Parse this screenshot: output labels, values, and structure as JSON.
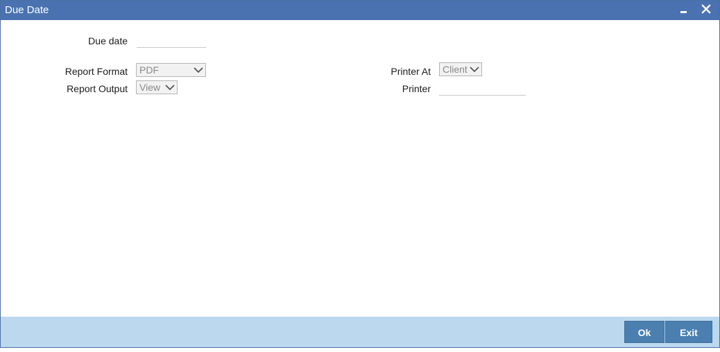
{
  "window": {
    "title": "Due Date"
  },
  "form": {
    "due_date_label": "Due date",
    "due_date_value": "",
    "report_format_label": "Report Format",
    "report_format_value": "PDF",
    "report_output_label": "Report Output",
    "report_output_value": "View",
    "printer_at_label": "Printer At",
    "printer_at_value": "Client",
    "printer_label": "Printer",
    "printer_value": ""
  },
  "footer": {
    "ok_label": "Ok",
    "exit_label": "Exit"
  },
  "colors": {
    "titlebar": "#4a72b0",
    "footer": "#bcd8ee",
    "button": "#4a7fb0"
  }
}
